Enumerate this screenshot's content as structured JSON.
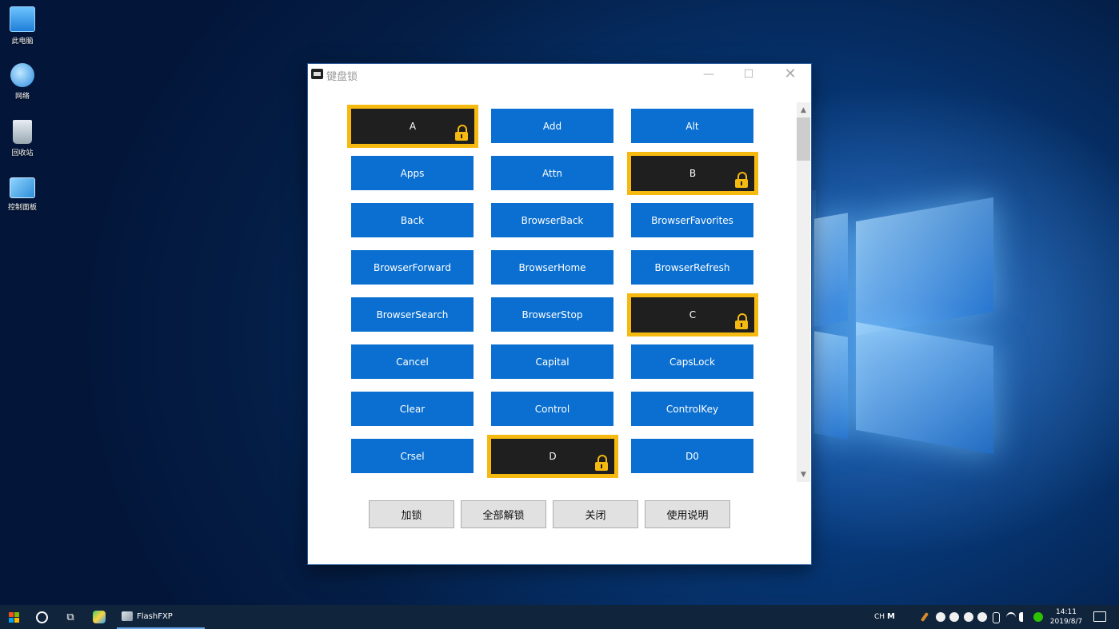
{
  "desktop": {
    "icons": [
      {
        "label": "此电脑",
        "icon": "computer-icon"
      },
      {
        "label": "网络",
        "icon": "network-icon"
      },
      {
        "label": "回收站",
        "icon": "recycle-bin-icon"
      },
      {
        "label": "控制面板",
        "icon": "control-panel-icon"
      }
    ]
  },
  "window": {
    "title": "键盘锁",
    "controls": {
      "minimize": "—",
      "maximize": "☐",
      "close": "✕"
    }
  },
  "keys": [
    {
      "label": "A",
      "locked": true
    },
    {
      "label": "Add",
      "locked": false
    },
    {
      "label": "Alt",
      "locked": false
    },
    {
      "label": "Apps",
      "locked": false
    },
    {
      "label": "Attn",
      "locked": false
    },
    {
      "label": "B",
      "locked": true
    },
    {
      "label": "Back",
      "locked": false
    },
    {
      "label": "BrowserBack",
      "locked": false
    },
    {
      "label": "BrowserFavorites",
      "locked": false
    },
    {
      "label": "BrowserForward",
      "locked": false
    },
    {
      "label": "BrowserHome",
      "locked": false
    },
    {
      "label": "BrowserRefresh",
      "locked": false
    },
    {
      "label": "BrowserSearch",
      "locked": false
    },
    {
      "label": "BrowserStop",
      "locked": false
    },
    {
      "label": "C",
      "locked": true
    },
    {
      "label": "Cancel",
      "locked": false
    },
    {
      "label": "Capital",
      "locked": false
    },
    {
      "label": "CapsLock",
      "locked": false
    },
    {
      "label": "Clear",
      "locked": false
    },
    {
      "label": "Control",
      "locked": false
    },
    {
      "label": "ControlKey",
      "locked": false
    },
    {
      "label": "Crsel",
      "locked": false
    },
    {
      "label": "D",
      "locked": true
    },
    {
      "label": "D0",
      "locked": false
    }
  ],
  "buttons": {
    "lock": "加锁",
    "unlock_all": "全部解锁",
    "close": "关闭",
    "help": "使用说明"
  },
  "colors": {
    "key_normal": "#0a6fd0",
    "key_locked_bg": "#1f1f1f",
    "key_locked_border": "#f5b90f"
  },
  "taskbar": {
    "app_label": "FlashFXP",
    "ime_lang": "CH",
    "ime_mode": "M",
    "time": "14:11",
    "date": "2019/8/7"
  }
}
